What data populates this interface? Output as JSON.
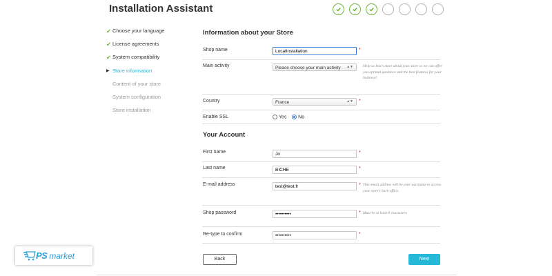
{
  "header": {
    "title": "Installation Assistant",
    "steps": [
      {
        "state": "done"
      },
      {
        "state": "done"
      },
      {
        "state": "done"
      },
      {
        "state": "todo"
      },
      {
        "state": "todo"
      },
      {
        "state": "todo"
      },
      {
        "state": "todo"
      }
    ]
  },
  "sidebar": {
    "items": [
      {
        "label": "Choose your language",
        "state": "done"
      },
      {
        "label": "License agreements",
        "state": "done"
      },
      {
        "label": "System compatibility",
        "state": "done"
      },
      {
        "label": "Store information",
        "state": "current"
      },
      {
        "label": "Content of your store",
        "state": "todo"
      },
      {
        "label": "System configuration",
        "state": "todo"
      },
      {
        "label": "Store installation",
        "state": "todo"
      }
    ]
  },
  "store": {
    "heading": "Information about your Store",
    "shop_name_label": "Shop name",
    "shop_name_value": "LocalInstallation",
    "main_activity_label": "Main activity",
    "main_activity_value": "Please choose your main activity",
    "main_activity_help": "Help us learn more about your store so we can offer you optimal guidance and the best features for your business!",
    "country_label": "Country",
    "country_value": "France",
    "ssl_label": "Enable SSL",
    "ssl_yes": "Yes",
    "ssl_no": "No",
    "ssl_selected": "No"
  },
  "account": {
    "heading": "Your Account",
    "first_name_label": "First name",
    "first_name_value": "Jo",
    "last_name_label": "Last name",
    "last_name_value": "BICHE",
    "email_label": "E-mail address",
    "email_value": "test@test.fr",
    "email_help": "This email address will be your username to access your store's back office.",
    "password_label": "Shop password",
    "password_value": "••••••••••",
    "password_help": "Must be at least 8 characters",
    "confirm_label": "Re-type to confirm",
    "confirm_value": "••••••••••"
  },
  "buttons": {
    "back": "Back",
    "next": "Next"
  },
  "logo": {
    "ps": "PS",
    "market": "market"
  },
  "required_mark": "*",
  "colors": {
    "accent": "#25b9d7",
    "done": "#6fb33b",
    "focus": "#3d7fd6",
    "required": "#ee0033"
  }
}
